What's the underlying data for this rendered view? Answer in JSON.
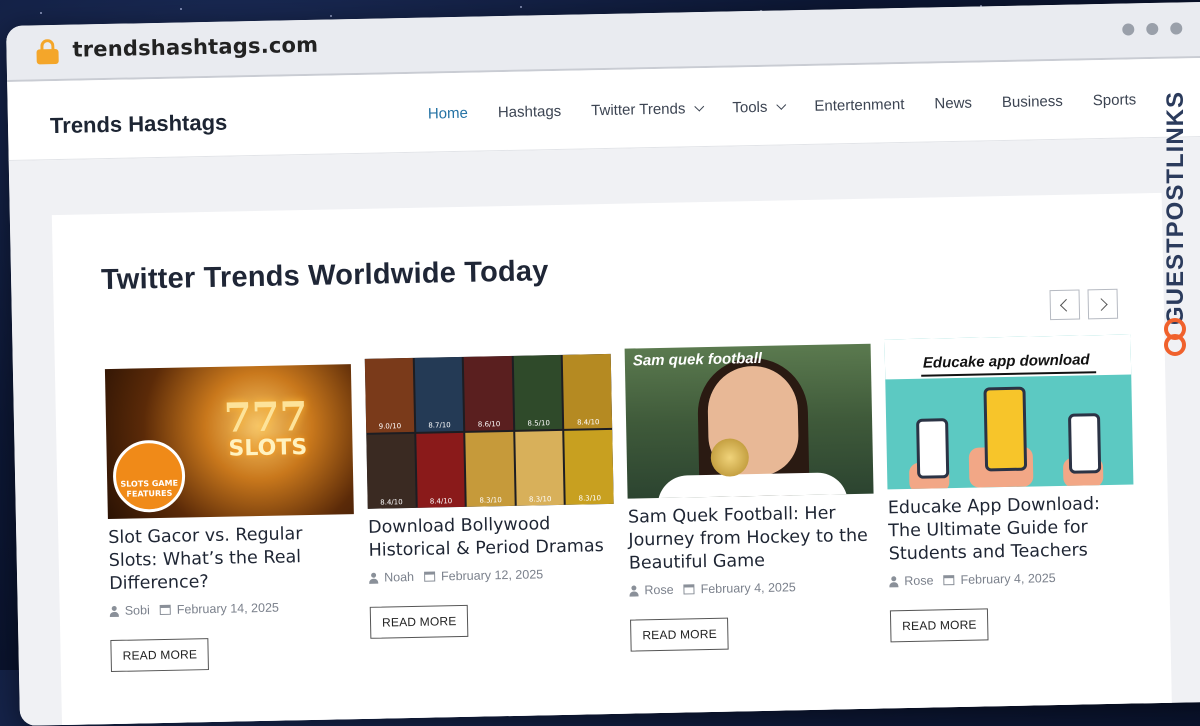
{
  "browser": {
    "url": "trendshashtags.com"
  },
  "site": {
    "logo": "Trends Hashtags",
    "nav": [
      {
        "label": "Home",
        "active": true,
        "dropdown": false
      },
      {
        "label": "Hashtags",
        "active": false,
        "dropdown": false
      },
      {
        "label": "Twitter Trends",
        "active": false,
        "dropdown": true
      },
      {
        "label": "Tools",
        "active": false,
        "dropdown": true
      },
      {
        "label": "Entertenment",
        "active": false,
        "dropdown": false
      },
      {
        "label": "News",
        "active": false,
        "dropdown": false
      },
      {
        "label": "Business",
        "active": false,
        "dropdown": false
      },
      {
        "label": "Sports",
        "active": false,
        "dropdown": false
      }
    ],
    "accent_color": "#2472a4"
  },
  "section": {
    "title": "Twitter Trends Worldwide Today"
  },
  "posts": [
    {
      "thumb_text": [
        "777",
        "SLOTS",
        "SLOTS GAME FEATURES"
      ],
      "title": "Slot Gacor vs. Regular Slots: What’s the Real Difference?",
      "author": "Sobi",
      "date": "February 14, 2025",
      "cta": "READ MORE"
    },
    {
      "thumb_text": [
        "9.0/10",
        "8.7/10",
        "8.6/10",
        "8.5/10",
        "8.4/10",
        "8.4/10",
        "8.4/10",
        "8.3/10",
        "8.3/10",
        "8.3/10"
      ],
      "title": "Download Bollywood Historical & Period Dramas",
      "author": "Noah",
      "date": "February 12, 2025",
      "cta": "READ MORE"
    },
    {
      "thumb_text": [
        "Sam quek football"
      ],
      "title": "Sam Quek Football: Her Journey from Hockey to the Beautiful Game",
      "author": "Rose",
      "date": "February 4, 2025",
      "cta": "READ MORE"
    },
    {
      "thumb_text": [
        "Educake app download"
      ],
      "title": "Educake App Download: The Ultimate Guide for Students and Teachers",
      "author": "Rose",
      "date": "February 4, 2025",
      "cta": "READ MORE"
    }
  ],
  "watermark": "GUESTPOSTLINKS"
}
